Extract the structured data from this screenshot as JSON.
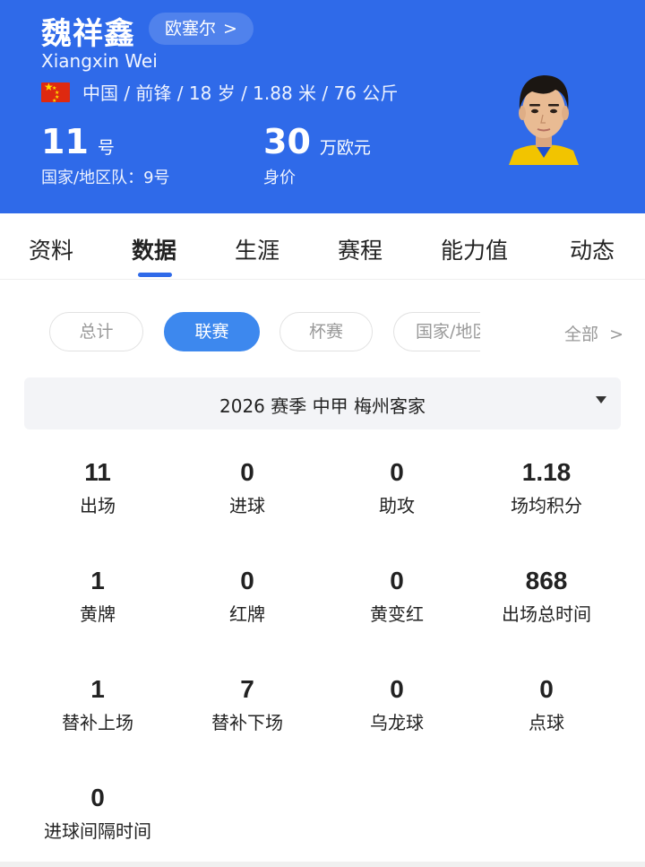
{
  "player": {
    "name_cn": "魏祥鑫",
    "team_link": "欧塞尔",
    "team_link_chevron": ">",
    "name_en": "Xiangxin Wei",
    "info": "中国 / 前锋 / 18 岁 / 1.88 米 / 76 公斤",
    "number": "11",
    "number_unit": "号",
    "national_team": "国家/地区队：9号",
    "value": "30",
    "value_unit": "万欧元",
    "value_label": "身价"
  },
  "tabs": [
    {
      "label": "资料"
    },
    {
      "label": "数据"
    },
    {
      "label": "生涯"
    },
    {
      "label": "赛程"
    },
    {
      "label": "能力值"
    },
    {
      "label": "动态"
    }
  ],
  "filters": [
    {
      "label": "总计"
    },
    {
      "label": "联赛"
    },
    {
      "label": "杯赛"
    },
    {
      "label": "国家/地区"
    }
  ],
  "all_link": "全部",
  "all_link_chevron": ">",
  "season": "2026 赛季  中甲  梅州客家",
  "stats": [
    {
      "value": "11",
      "label": "出场"
    },
    {
      "value": "0",
      "label": "进球"
    },
    {
      "value": "0",
      "label": "助攻"
    },
    {
      "value": "1.18",
      "label": "场均积分"
    },
    {
      "value": "1",
      "label": "黄牌"
    },
    {
      "value": "0",
      "label": "红牌"
    },
    {
      "value": "0",
      "label": "黄变红"
    },
    {
      "value": "868",
      "label": "出场总时间"
    },
    {
      "value": "1",
      "label": "替补上场"
    },
    {
      "value": "7",
      "label": "替补下场"
    },
    {
      "value": "0",
      "label": "乌龙球"
    },
    {
      "value": "0",
      "label": "点球"
    },
    {
      "value": "0",
      "label": "进球间隔时间"
    }
  ],
  "colors": {
    "header_bg": "#2f6ae9",
    "accent": "#3d88ee",
    "flag_red": "#de2910",
    "flag_yellow": "#ffde00"
  },
  "icons": [
    "china-flag-icon",
    "chevron-right-icon",
    "dropdown-caret-icon",
    "player-avatar"
  ]
}
